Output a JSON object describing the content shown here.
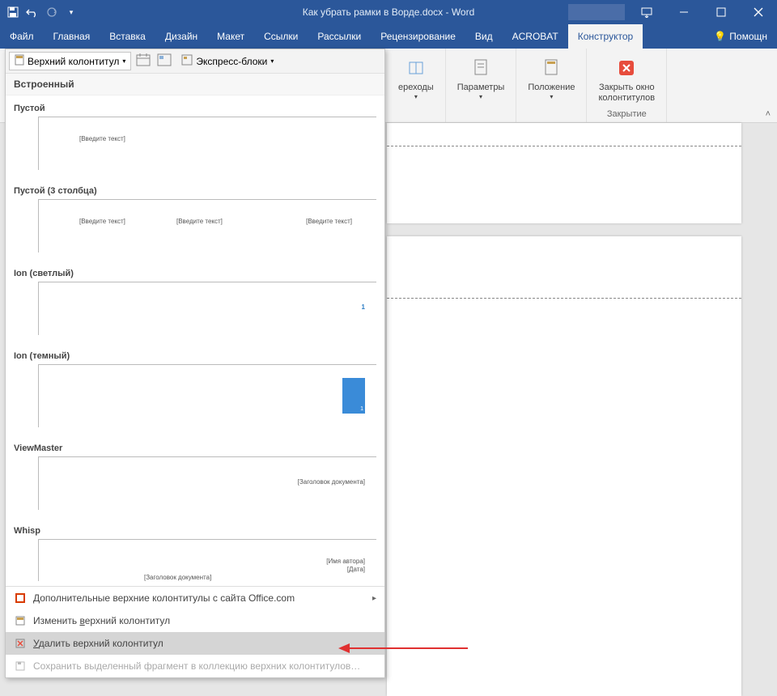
{
  "titlebar": {
    "doc_title": "Как убрать рамки в Ворде.docx - Word"
  },
  "tabs": {
    "file": "Файл",
    "home": "Главная",
    "insert": "Вставка",
    "design": "Дизайн",
    "layout": "Макет",
    "references": "Ссылки",
    "mailings": "Рассылки",
    "review": "Рецензирование",
    "view": "Вид",
    "acrobat": "ACROBAT",
    "designer": "Конструктор",
    "help": "Помощн"
  },
  "ribbon": {
    "header_btn": "Верхний колонтитул",
    "express_blocks": "Экспресс-блоки",
    "transitions": "ереходы",
    "parameters": "Параметры",
    "position": "Положение",
    "close_header": "Закрыть окно\nколонтитулов",
    "close_group": "Закрытие"
  },
  "gallery": {
    "section_builtin": "Встроенный",
    "items": [
      {
        "title": "Пустой",
        "placeholders": [
          "[Введите текст]"
        ]
      },
      {
        "title": "Пустой (3 столбца)",
        "placeholders": [
          "[Введите текст]",
          "[Введите текст]",
          "[Введите текст]"
        ]
      },
      {
        "title": "Ion (светлый)",
        "page_num": "1"
      },
      {
        "title": "Ion (темный)",
        "page_num": "1"
      },
      {
        "title": "ViewMaster",
        "right_text": "[Заголовок документа]"
      },
      {
        "title": "Whisp",
        "right_text1": "[Имя автора]",
        "right_text2": "[Дата]",
        "left_text": "[Заголовок документа]"
      }
    ],
    "menu": {
      "more_office": "Дополнительные верхние колонтитулы с сайта Office.com",
      "edit": "Изменить верхний колонтитул",
      "delete": "Удалить верхний колонтитул",
      "save_selection": "Сохранить выделенный фрагмент в коллекцию верхних колонтитулов…"
    }
  }
}
